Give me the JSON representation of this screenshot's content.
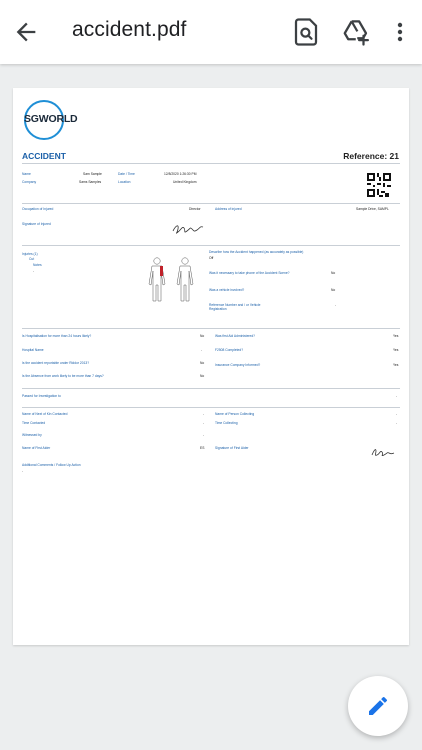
{
  "app": {
    "file_name": "accident.pdf"
  },
  "icons": {
    "back": "arrow-back-icon",
    "search": "search-in-document-icon",
    "drive": "add-to-drive-icon",
    "more": "more-vert-icon",
    "edit": "edit-pencil-icon"
  },
  "colors": {
    "accent": "#1a73e8",
    "doc_blue": "#1a5fa8",
    "logo_blue": "#1f8fd6"
  },
  "doc": {
    "logo_text": "SGWORLD",
    "heading": "ACCIDENT",
    "reference": "Reference: 21",
    "name_label": "Name",
    "name_value": "Sam Sample",
    "datetime_label": "Date / Time",
    "datetime_value": "12/8/2020 1:26:30 PM",
    "company_label": "Company",
    "company_value": "Sams Samples",
    "location_label": "Location",
    "location_value": "United Kingdom",
    "occupation_label": "Occupation of Injured",
    "occupation_value": "Director",
    "address_label": "Address of injured",
    "address_value": "Sample Drive, SAMPL",
    "signature_label": "Signature of Injured",
    "injuries_label": "Injuries (1)",
    "injury_item": "Cut",
    "notes_label": "Notes",
    "notes_value": "-",
    "describe_label": "Describe how the Accident happened (as accurately as possible)",
    "describe_value": "Off",
    "phone_label": "Was it necessary to take phone of the Accident Scene?",
    "phone_value": "No",
    "vehicle_label": "Was a vehicle involved?",
    "vehicle_value": "No",
    "reg_label": "Reference Number and / or Vehicle Registration",
    "reg_value": "-",
    "hosp_label": "Is Hospitalisation for more than 24 hours likely?",
    "hosp_value": "No",
    "firstaid_label": "Was first Aid Administered?",
    "firstaid_value": "Yes",
    "hospname_label": "Hospital Name",
    "hospname_value": "-",
    "f2508_label": "F2508 Completed?",
    "f2508_value": "Yes",
    "riddor_label": "Is the accident reportable under Riddor 2013?",
    "riddor_value": "No",
    "insurance_label": "Insurance Company Informed?",
    "insurance_value": "Yes",
    "absence_label": "Is the Absence from work likely to be more than 7 days?",
    "absence_value": "No",
    "passed_label": "Passed for Investigation to",
    "passed_value": "-",
    "kin_label": "Name of Next of Kin Contacted",
    "kin_value": "-",
    "collect_label": "Name of Person Collecting",
    "collect_value": "-",
    "timecontact_label": "Time Contacted",
    "timecontact_value": "-",
    "timecollect_label": "Time Collecting",
    "timecollect_value": "-",
    "witness_label": "Witnessed by",
    "witness_value": "-",
    "firstaider_label": "Name of First Aider",
    "firstaider_value": "ES",
    "sigfirstaider_label": "Signature of First Aider",
    "comments_label": "Additional Comments / Follow Up Action",
    "comments_value": "-"
  }
}
